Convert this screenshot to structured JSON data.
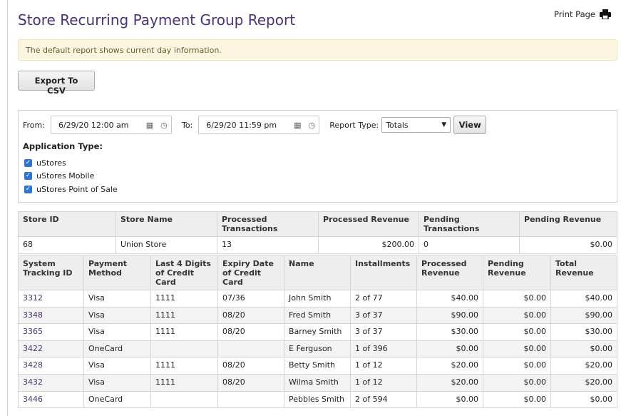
{
  "page_title": "Store Recurring Payment Group Report",
  "print_label": "Print Page",
  "alert_text": "The default report shows current day information.",
  "export_label": "Export To CSV",
  "filters": {
    "from_label": "From:",
    "from_value": "6/29/20 12:00 am",
    "to_label": "To:",
    "to_value": "6/29/20 11:59 pm",
    "report_type_label": "Report Type:",
    "report_type_value": "Totals",
    "view_label": "View",
    "application_type_label": "Application Type:",
    "app_types": [
      "uStores",
      "uStores Mobile",
      "uStores Point of Sale"
    ]
  },
  "store_table": {
    "headers": [
      "Store ID",
      "Store Name",
      "Processed Transactions",
      "Processed Revenue",
      "Pending Transactions",
      "Pending Revenue"
    ],
    "row": [
      "68",
      "Union Store",
      "13",
      "$200.00",
      "0",
      "$0.00"
    ]
  },
  "payments_table": {
    "headers": [
      "System Tracking ID",
      "Payment Method",
      "Last 4 Digits of Credit Card",
      "Expiry Date of Credit Card",
      "Name",
      "Installments",
      "Processed Revenue",
      "Pending Revenue",
      "Total Revenue"
    ],
    "rows": [
      [
        "3312",
        "Visa",
        "1111",
        "07/36",
        "John Smith",
        "2 of 77",
        "$40.00",
        "$0.00",
        "$40.00"
      ],
      [
        "3348",
        "Visa",
        "1111",
        "08/20",
        "Fred Smith",
        "3 of 37",
        "$90.00",
        "$0.00",
        "$90.00"
      ],
      [
        "3365",
        "Visa",
        "1111",
        "08/20",
        "Barney Smith",
        "3 of 37",
        "$30.00",
        "$0.00",
        "$30.00"
      ],
      [
        "3422",
        "OneCard",
        "",
        "",
        "E Ferguson",
        "1 of 396",
        "$0.00",
        "$0.00",
        "$0.00"
      ],
      [
        "3428",
        "Visa",
        "1111",
        "08/20",
        "Betty Smith",
        "1 of 12",
        "$20.00",
        "$0.00",
        "$20.00"
      ],
      [
        "3432",
        "Visa",
        "1111",
        "08/20",
        "Wilma Smith",
        "1 of 12",
        "$20.00",
        "$0.00",
        "$20.00"
      ],
      [
        "3446",
        "OneCard",
        "",
        "",
        "Pebbles Smith",
        "2 of 594",
        "$0.00",
        "$0.00",
        "$0.00"
      ]
    ]
  }
}
